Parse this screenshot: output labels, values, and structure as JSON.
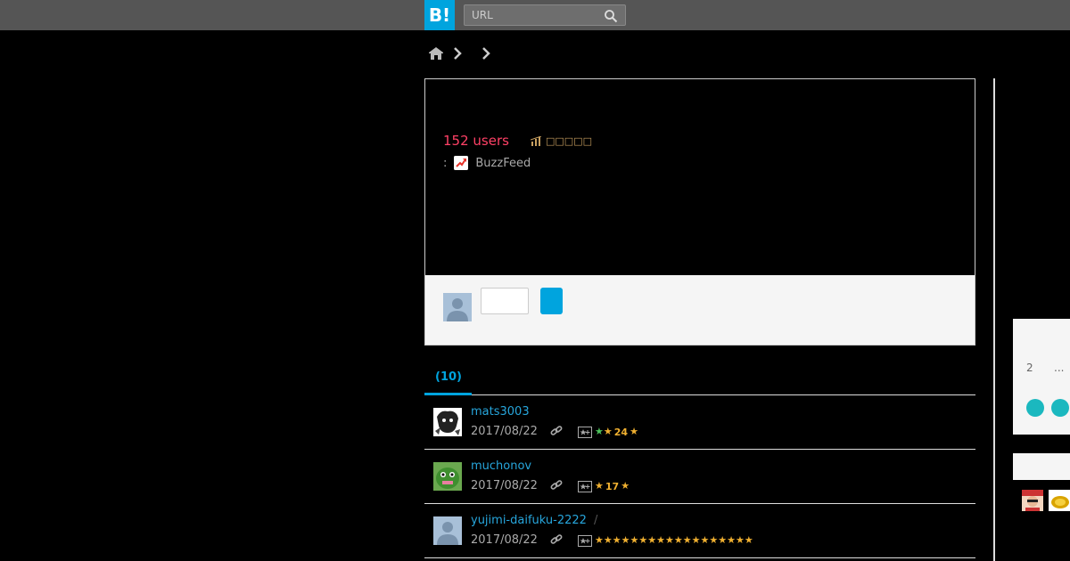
{
  "header": {
    "logo_text": "B!",
    "search": {
      "placeholder": "URL",
      "value": ""
    }
  },
  "entry": {
    "users": "152 users",
    "source_prefix": ":",
    "source_name": "BuzzFeed",
    "stats_glyphs": "□□□□□"
  },
  "comments": {
    "tab_label": "(10)"
  },
  "bookmarks": [
    {
      "user": "mats3003",
      "date": "2017/08/22",
      "separator": "",
      "star_count": "24",
      "stars": [
        "green",
        "yellow"
      ]
    },
    {
      "user": "muchonov",
      "date": "2017/08/22",
      "separator": "",
      "star_count": "17",
      "stars": [
        "yellow"
      ]
    },
    {
      "user": "yujimi-daifuku-2222",
      "date": "2017/08/22",
      "separator": "/",
      "star_count": "",
      "stars": [
        "yellow",
        "yellow",
        "yellow",
        "yellow",
        "yellow",
        "yellow",
        "yellow",
        "yellow",
        "yellow",
        "yellow",
        "yellow",
        "yellow",
        "yellow",
        "yellow",
        "yellow",
        "yellow",
        "yellow",
        "yellow"
      ]
    }
  ],
  "sidebar": {
    "page_number": "2",
    "ellipsis": "..."
  },
  "colors": {
    "brand": "#00a4de",
    "users": "#ff4166",
    "username": "#27a6dc",
    "teal": "#1bb8bf"
  }
}
